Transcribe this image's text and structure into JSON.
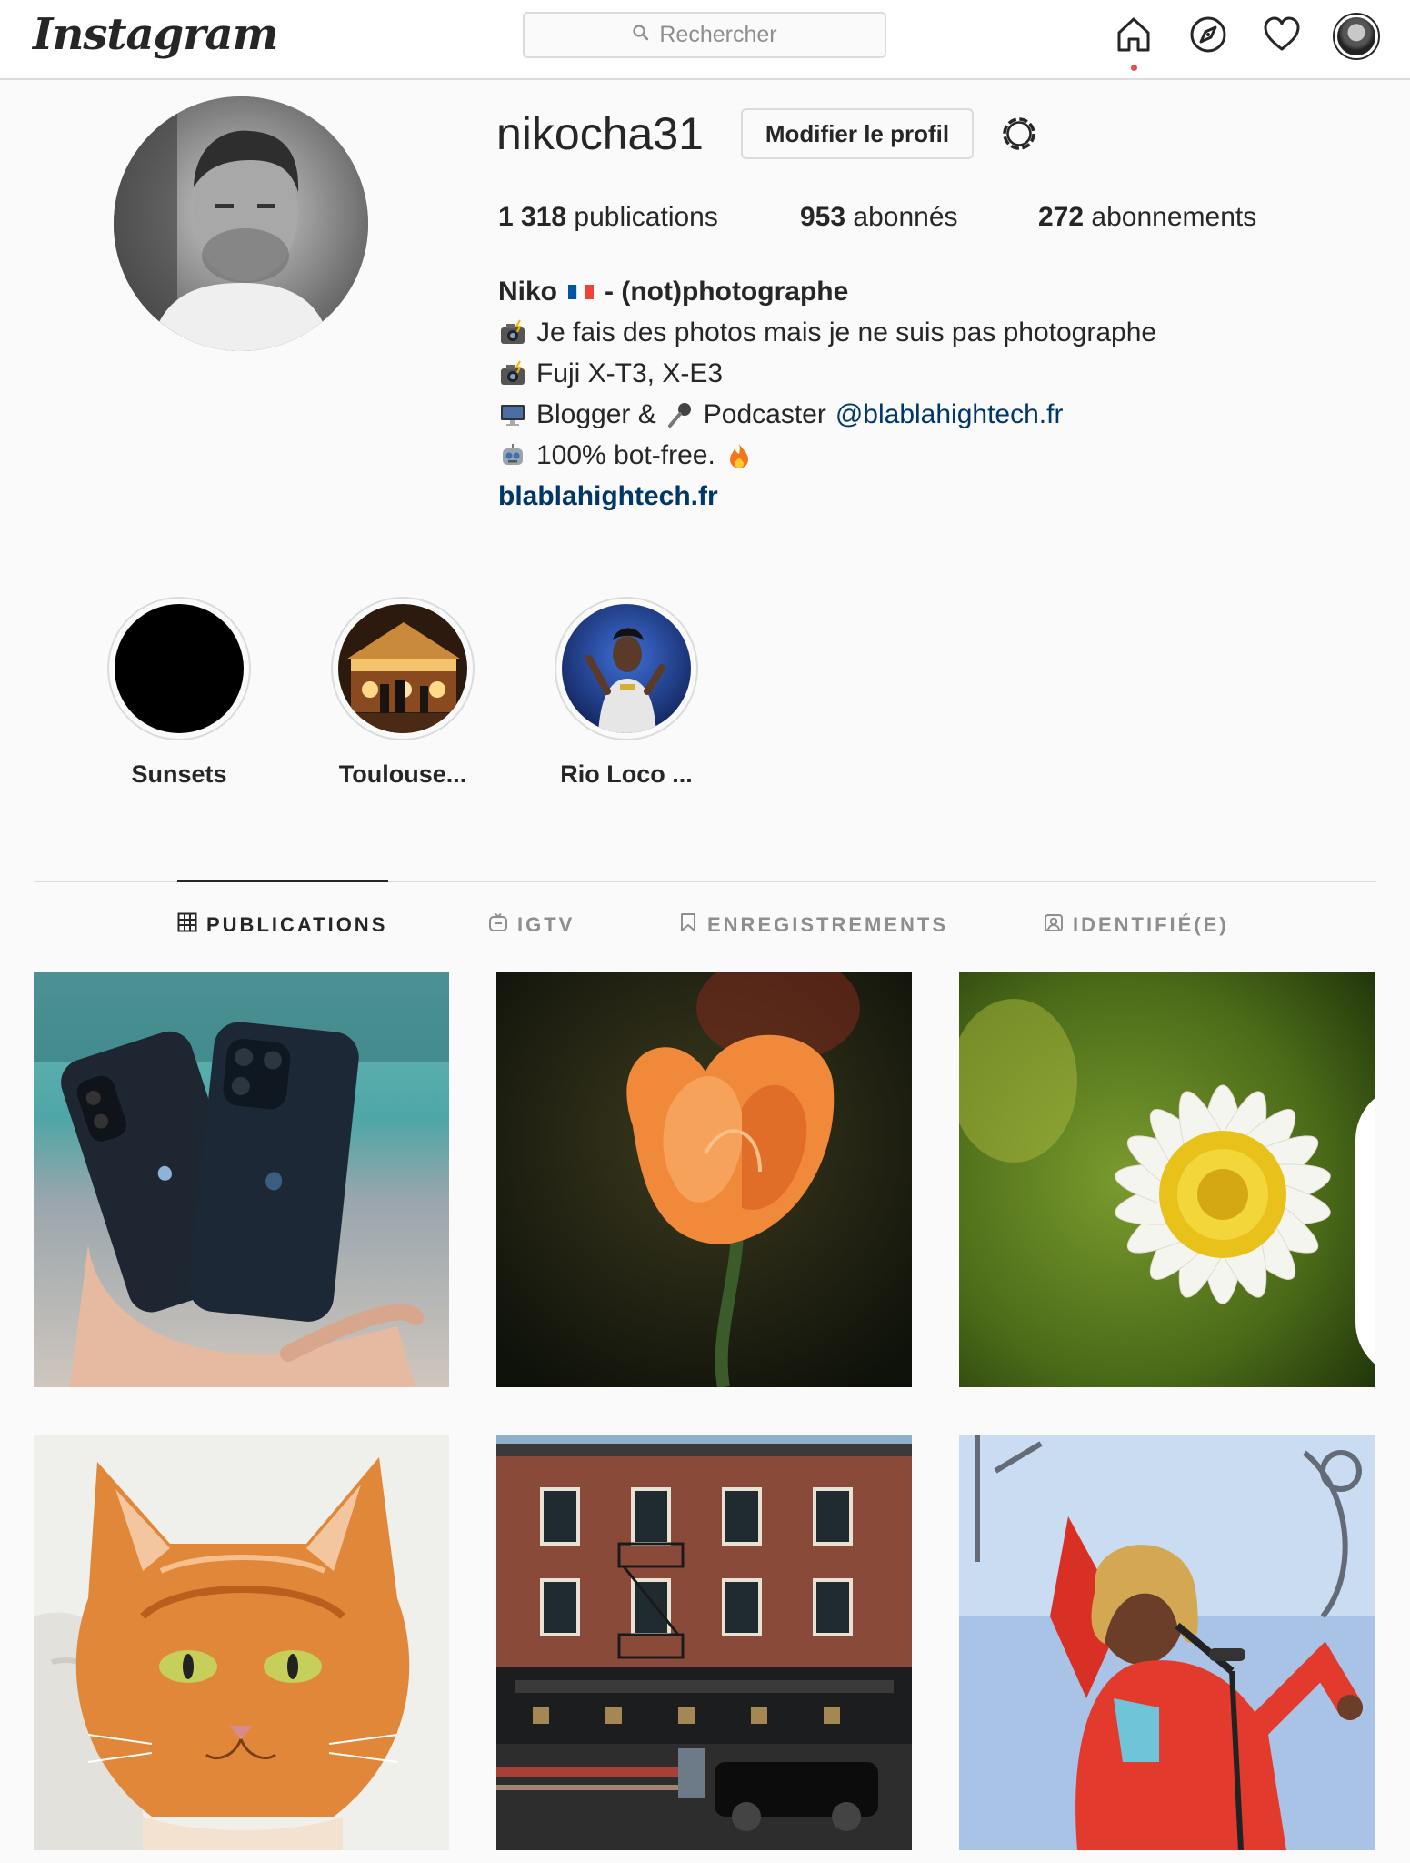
{
  "header": {
    "logo": "Instagram",
    "search_placeholder": "Rechercher",
    "icons": [
      "home-icon",
      "explore-icon",
      "heart-icon",
      "profile-avatar"
    ]
  },
  "profile": {
    "username": "nikocha31",
    "edit_button": "Modifier le profil",
    "stats": {
      "posts_count": "1 318",
      "posts_label": "publications",
      "followers_count": "953",
      "followers_label": "abonnés",
      "following_count": "272",
      "following_label": "abonnements"
    },
    "bio": {
      "name_prefix": "Niko",
      "name_suffix": "- (not)photographe",
      "line1": "Je fais des photos mais je ne suis pas photographe",
      "line2": "Fuji X-T3, X-E3",
      "line3_a": "Blogger &",
      "line3_b": "Podcaster",
      "line3_mention": "@blablahightech.fr",
      "line4": "100% bot-free.",
      "website": "blablahightech.fr"
    }
  },
  "highlights": [
    {
      "label": "Sunsets"
    },
    {
      "label": "Toulouse..."
    },
    {
      "label": "Rio Loco ..."
    }
  ],
  "tabs": [
    {
      "label": "PUBLICATIONS",
      "active": true
    },
    {
      "label": "IGTV",
      "active": false
    },
    {
      "label": "ENREGISTREMENTS",
      "active": false
    },
    {
      "label": "IDENTIFIÉ(E)",
      "active": false
    }
  ],
  "posts": [
    {
      "subject": "iphone-photo"
    },
    {
      "subject": "tulip-photo"
    },
    {
      "subject": "daisy-photo",
      "multiple": true
    },
    {
      "subject": "cat-photo"
    },
    {
      "subject": "building-photo"
    },
    {
      "subject": "singer-photo"
    }
  ],
  "colors": {
    "background": "#fafafa",
    "border": "#dbdbdb",
    "text": "#262626",
    "secondary_text": "#8e8e8e",
    "link": "#00376b",
    "notification": "#ed4956"
  }
}
